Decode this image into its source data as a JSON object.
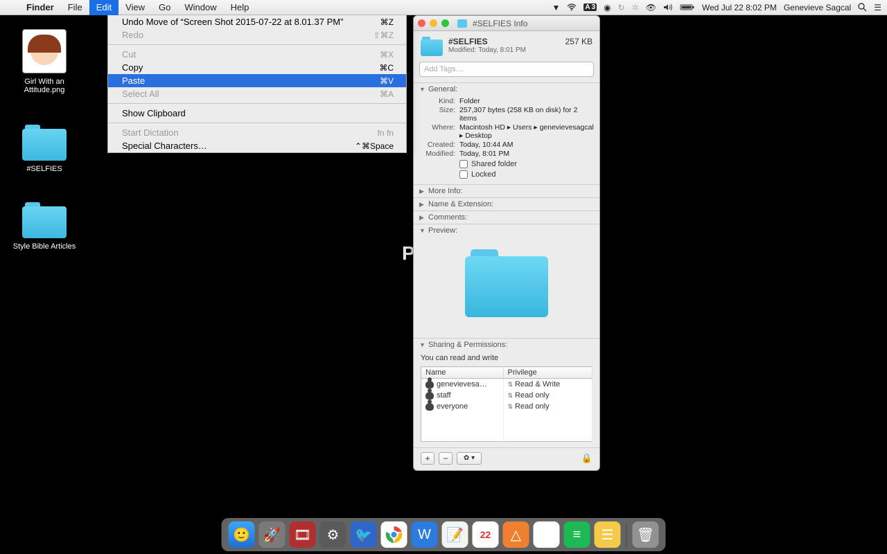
{
  "menubar": {
    "app": "Finder",
    "items": [
      "File",
      "Edit",
      "View",
      "Go",
      "Window",
      "Help"
    ],
    "active_index": 1,
    "status": {
      "adobe_count": "3",
      "datetime": "Wed Jul 22  8:02 PM",
      "user": "Genevieve Sagcal"
    }
  },
  "desktop": {
    "icons": [
      {
        "label": "Girl With an Attitude.png",
        "type": "image"
      },
      {
        "label": "#SELFIES",
        "type": "folder"
      },
      {
        "label": "Style Bible Articles",
        "type": "folder"
      }
    ]
  },
  "edit_menu": {
    "items": [
      {
        "label": "Undo Move of “Screen Shot 2015-07-22 at 8.01.37 PM”",
        "shortcut": "⌘Z",
        "enabled": true
      },
      {
        "label": "Redo",
        "shortcut": "⇧⌘Z",
        "enabled": false
      },
      {
        "sep": true
      },
      {
        "label": "Cut",
        "shortcut": "⌘X",
        "enabled": false
      },
      {
        "label": "Copy",
        "shortcut": "⌘C",
        "enabled": true
      },
      {
        "label": "Paste",
        "shortcut": "⌘V",
        "enabled": true,
        "highlight": true
      },
      {
        "label": "Select All",
        "shortcut": "⌘A",
        "enabled": false
      },
      {
        "sep": true
      },
      {
        "label": "Show Clipboard",
        "shortcut": "",
        "enabled": true
      },
      {
        "sep": true
      },
      {
        "label": "Start Dictation",
        "shortcut": "fn fn",
        "enabled": false
      },
      {
        "label": "Special Characters…",
        "shortcut": "⌃⌘Space",
        "enabled": true
      }
    ]
  },
  "info": {
    "title": "#SELFIES Info",
    "name": "#SELFIES",
    "size": "257 KB",
    "modified_short": "Modified: Today, 8:01 PM",
    "tags_placeholder": "Add Tags…",
    "sections": {
      "general": "General:",
      "moreinfo": "More Info:",
      "nameext": "Name & Extension:",
      "comments": "Comments:",
      "preview": "Preview:",
      "sharing": "Sharing & Permissions:"
    },
    "general": {
      "kind_k": "Kind:",
      "kind_v": "Folder",
      "size_k": "Size:",
      "size_v": "257,307 bytes (258 KB on disk) for 2 items",
      "where_k": "Where:",
      "where_v": "Macintosh HD ▸ Users ▸ genevievesagcal ▸ Desktop",
      "created_k": "Created:",
      "created_v": "Today, 10:44 AM",
      "modified_k": "Modified:",
      "modified_v": "Today, 8:01 PM",
      "shared": "Shared folder",
      "locked": "Locked"
    },
    "sharing": {
      "desc": "You can read and write",
      "headers": {
        "name": "Name",
        "priv": "Privilege"
      },
      "rows": [
        {
          "name": "genevievesa…",
          "priv": "Read & Write"
        },
        {
          "name": "staff",
          "priv": "Read only"
        },
        {
          "name": "everyone",
          "priv": "Read only"
        }
      ]
    }
  },
  "bg_text": "P",
  "dock": {
    "apps": [
      {
        "name": "finder",
        "bg": "linear-gradient(#3ba7f5,#1d6fd6)",
        "glyph": "🙂"
      },
      {
        "name": "launchpad",
        "bg": "#7a7a7a",
        "glyph": "🚀"
      },
      {
        "name": "photobooth",
        "bg": "#b03030",
        "glyph": "🎞"
      },
      {
        "name": "settings",
        "bg": "#5a5a5a",
        "glyph": "⚙"
      },
      {
        "name": "mail-bird",
        "bg": "#2f67c9",
        "glyph": "🐦"
      },
      {
        "name": "chrome",
        "bg": "#fff",
        "glyph": "◯"
      },
      {
        "name": "word",
        "bg": "#2c7be0",
        "glyph": "W"
      },
      {
        "name": "notes",
        "bg": "#f3f3ef",
        "glyph": "📝"
      },
      {
        "name": "calendar",
        "bg": "#fff",
        "glyph": "22"
      },
      {
        "name": "vlc",
        "bg": "#f08030",
        "glyph": "△"
      },
      {
        "name": "itunes",
        "bg": "#fff",
        "glyph": "♪"
      },
      {
        "name": "spotify",
        "bg": "#1db954",
        "glyph": "≡"
      },
      {
        "name": "stickies",
        "bg": "#f5c94a",
        "glyph": "☰"
      }
    ],
    "trash": "🗑"
  }
}
